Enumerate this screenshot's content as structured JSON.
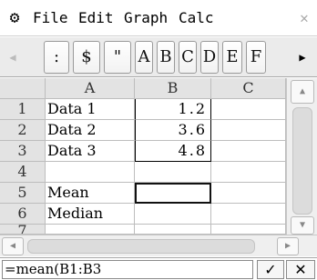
{
  "menu": {
    "icon": "gear-icon",
    "items": [
      "File",
      "Edit",
      "Graph",
      "Calc"
    ]
  },
  "toolbar": {
    "buttons": [
      ":",
      "$",
      "\"",
      "A",
      "B",
      "C",
      "D",
      "E",
      "F"
    ]
  },
  "grid": {
    "columns": [
      "A",
      "B",
      "C"
    ],
    "rows": [
      {
        "num": "1",
        "a": "Data 1",
        "b": "1.2",
        "c": ""
      },
      {
        "num": "2",
        "a": "Data 2",
        "b": "3.6",
        "c": ""
      },
      {
        "num": "3",
        "a": "Data 3",
        "b": "4.8",
        "c": ""
      },
      {
        "num": "4",
        "a": "",
        "b": "",
        "c": ""
      },
      {
        "num": "5",
        "a": "Mean",
        "b": "",
        "c": ""
      },
      {
        "num": "6",
        "a": "Median",
        "b": "",
        "c": ""
      },
      {
        "num": "7",
        "a": "",
        "b": "",
        "c": ""
      }
    ]
  },
  "formula": {
    "value": "=mean(B1:B3",
    "ok_label": "✓",
    "cancel_label": "✕"
  }
}
